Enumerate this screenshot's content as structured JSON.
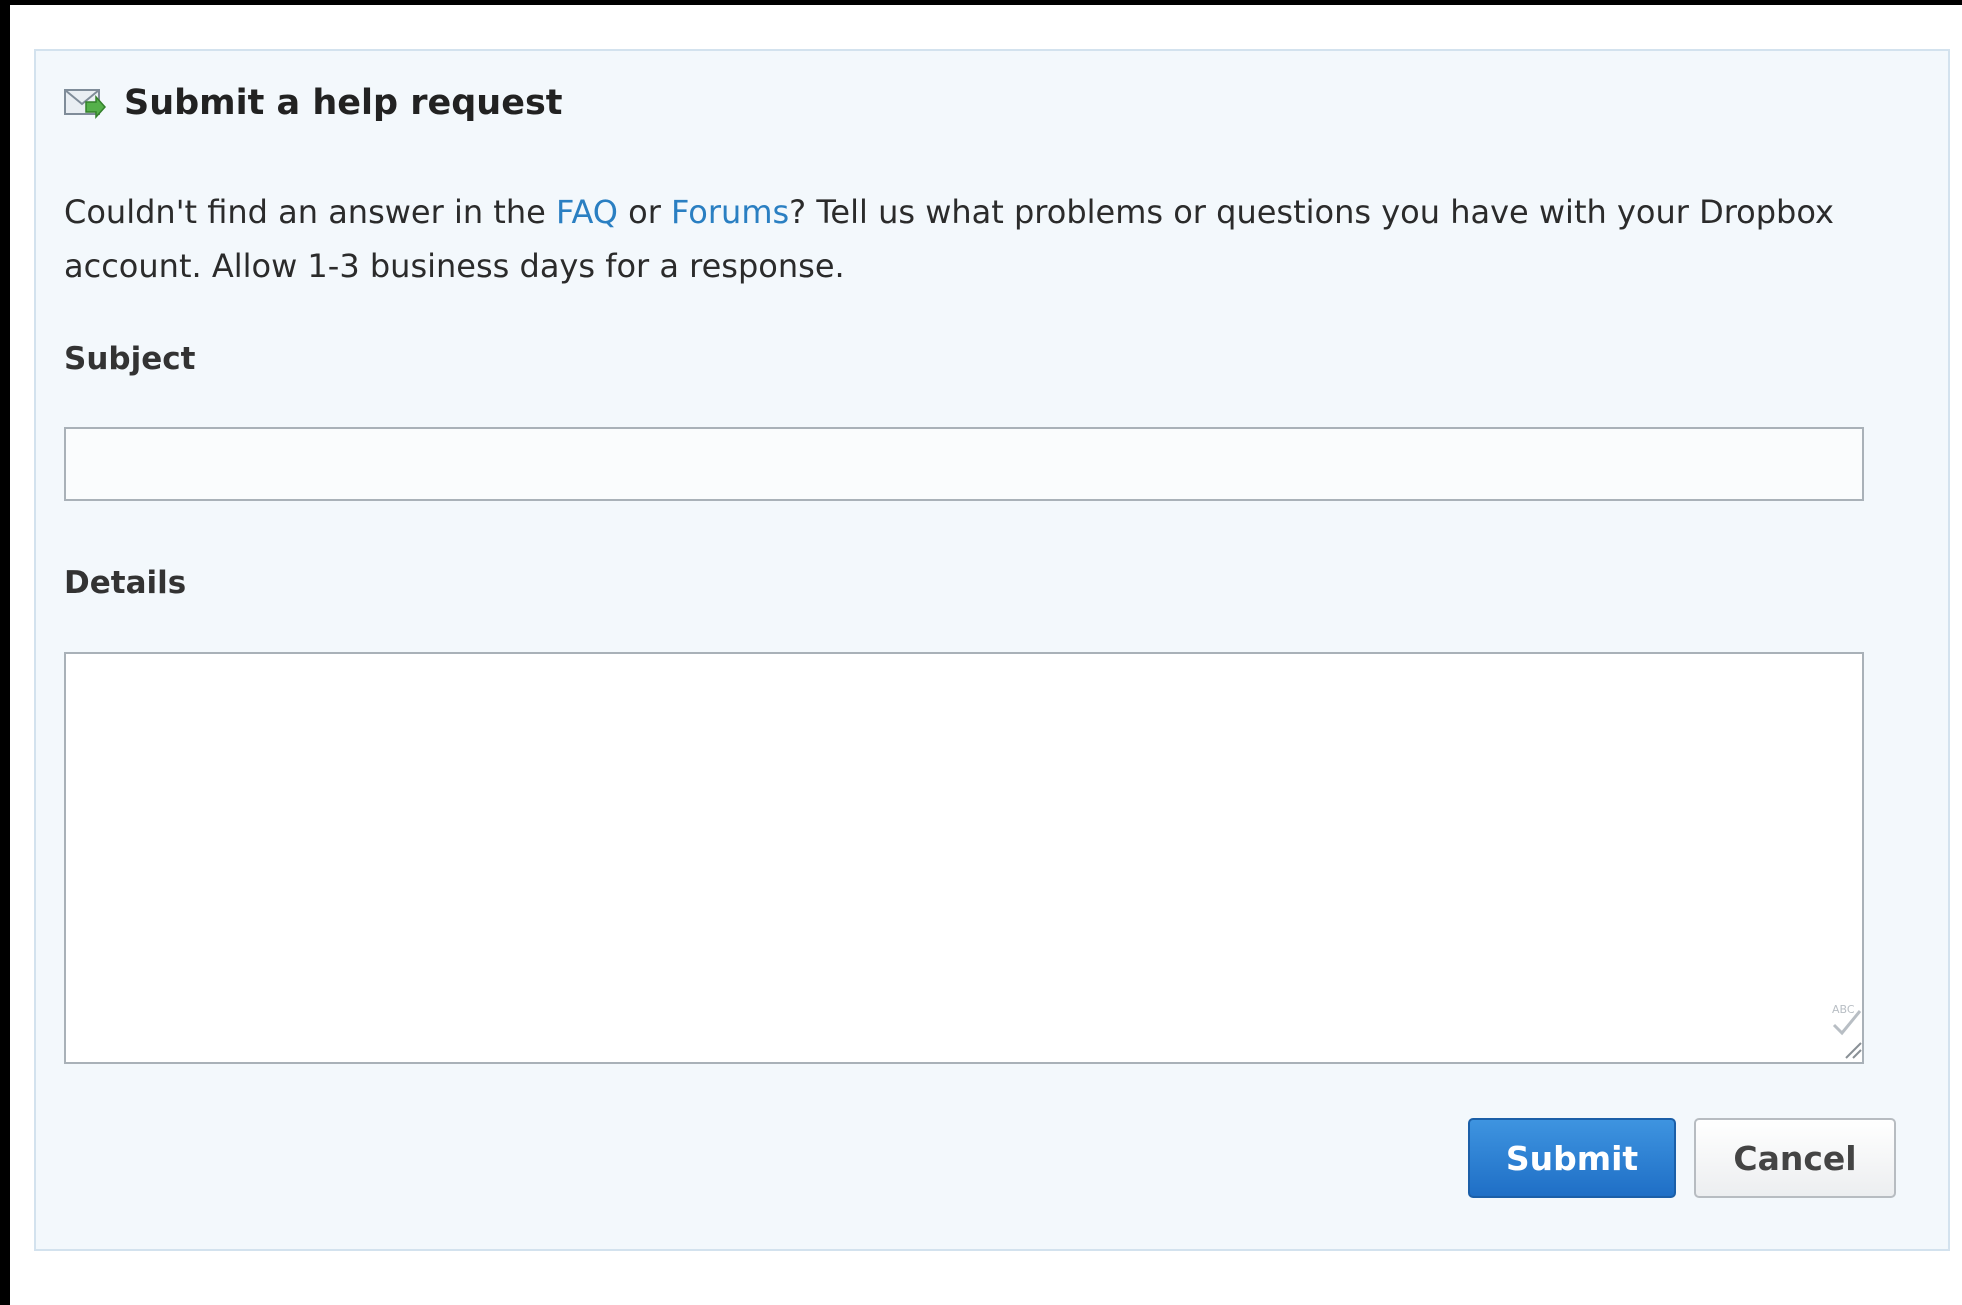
{
  "form": {
    "title": "Submit a help request",
    "description": {
      "prefix": "Couldn't find an answer in the ",
      "faq_link": "FAQ",
      "middle": " or ",
      "forums_link": "Forums",
      "suffix": "? Tell us what problems or questions you have with your Dropbox account. Allow 1-3 business days for a response."
    },
    "subject": {
      "label": "Subject",
      "value": "",
      "placeholder": ""
    },
    "details": {
      "label": "Details",
      "value": "",
      "placeholder": ""
    },
    "buttons": {
      "submit_label": "Submit",
      "cancel_label": "Cancel"
    }
  },
  "icons": {
    "title_icon": "mail-arrow-icon",
    "spellcheck_icon": "spellcheck-icon",
    "resize_icon": "resize-handle-icon"
  },
  "colors": {
    "link": "#2a7fc2",
    "submit_button": "#2a7fc2",
    "panel_background": "#f3f8fc",
    "panel_border": "#d3e2ee"
  }
}
